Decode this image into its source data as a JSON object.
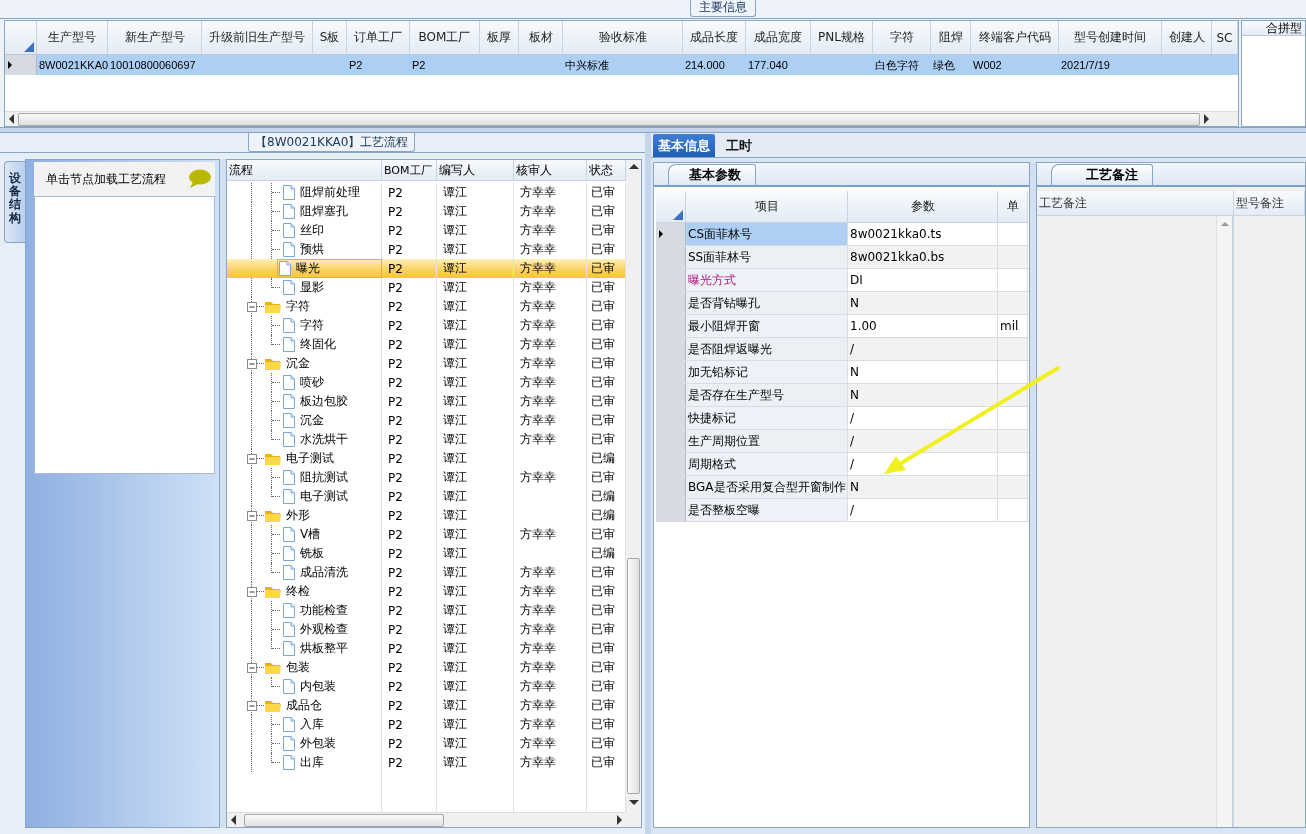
{
  "main_info": {
    "title": "主要信息",
    "columns": [
      "生产型号",
      "新生产型号",
      "升级前旧生产型号",
      "S板",
      "订单工厂",
      "BOM工厂",
      "板厚",
      "板材",
      "验收标准",
      "成品长度",
      "成品宽度",
      "PNL规格",
      "字符",
      "阻焊",
      "终端客户代码",
      "型号创建时间",
      "创建人",
      "SC"
    ],
    "rows": [
      {
        "selected": true,
        "cells": [
          "8W0021KKA0",
          "10010800060697",
          null,
          null,
          "P2",
          "P2",
          null,
          null,
          "中兴标准",
          "214.000",
          "177.040",
          null,
          "白色字符",
          "绿色",
          "W002",
          "2021/7/19",
          null,
          null
        ]
      }
    ]
  },
  "merge_panel": {
    "title": "合拼型"
  },
  "process_flow": {
    "title": "【8W0021KKA0】工艺流程",
    "side_tab": "设备结构",
    "hint": "单击节点加载工艺流程",
    "columns": [
      "流程",
      "BOM工厂",
      "编写人",
      "核审人",
      "状态"
    ],
    "groups": [
      {
        "children": [
          {
            "label": "阻焊前处理",
            "bom": "P2",
            "writer": "谭江",
            "reviewer": "方幸幸",
            "status": "已审",
            "selected": false
          },
          {
            "label": "阻焊塞孔",
            "bom": "P2",
            "writer": "谭江",
            "reviewer": "方幸幸",
            "status": "已审",
            "selected": false
          },
          {
            "label": "丝印",
            "bom": "P2",
            "writer": "谭江",
            "reviewer": "方幸幸",
            "status": "已审",
            "selected": false
          },
          {
            "label": "预烘",
            "bom": "P2",
            "writer": "谭江",
            "reviewer": "方幸幸",
            "status": "已审",
            "selected": false
          },
          {
            "label": "曝光",
            "bom": "P2",
            "writer": "谭江",
            "reviewer": "方幸幸",
            "status": "已审",
            "selected": true
          },
          {
            "label": "显影",
            "bom": "P2",
            "writer": "谭江",
            "reviewer": "方幸幸",
            "status": "已审",
            "selected": false
          }
        ]
      },
      {
        "label": "字符",
        "bom": "P2",
        "writer": "谭江",
        "reviewer": "方幸幸",
        "status": "已审",
        "selected": false,
        "expanded": true,
        "children": [
          {
            "label": "字符",
            "bom": "P2",
            "writer": "谭江",
            "reviewer": "方幸幸",
            "status": "已审",
            "selected": false
          },
          {
            "label": "终固化",
            "bom": "P2",
            "writer": "谭江",
            "reviewer": "方幸幸",
            "status": "已审",
            "selected": false
          }
        ]
      },
      {
        "label": "沉金",
        "bom": "P2",
        "writer": "谭江",
        "reviewer": "方幸幸",
        "status": "已审",
        "selected": false,
        "expanded": true,
        "children": [
          {
            "label": "喷砂",
            "bom": "P2",
            "writer": "谭江",
            "reviewer": "方幸幸",
            "status": "已审",
            "selected": false
          },
          {
            "label": "板边包胶",
            "bom": "P2",
            "writer": "谭江",
            "reviewer": "方幸幸",
            "status": "已审",
            "selected": false
          },
          {
            "label": "沉金",
            "bom": "P2",
            "writer": "谭江",
            "reviewer": "方幸幸",
            "status": "已审",
            "selected": false
          },
          {
            "label": "水洗烘干",
            "bom": "P2",
            "writer": "谭江",
            "reviewer": "方幸幸",
            "status": "已审",
            "selected": false
          }
        ]
      },
      {
        "label": "电子测试",
        "bom": "P2",
        "writer": "谭江",
        "status": "已编",
        "selected": false,
        "expanded": true,
        "children": [
          {
            "label": "阻抗测试",
            "bom": "P2",
            "writer": "谭江",
            "reviewer": "方幸幸",
            "status": "已审",
            "selected": false
          },
          {
            "label": "电子测试",
            "bom": "P2",
            "writer": "谭江",
            "status": "已编",
            "selected": false
          }
        ]
      },
      {
        "label": "外形",
        "bom": "P2",
        "writer": "谭江",
        "status": "已编",
        "selected": false,
        "expanded": true,
        "children": [
          {
            "label": "V槽",
            "bom": "P2",
            "writer": "谭江",
            "reviewer": "方幸幸",
            "status": "已审",
            "selected": false
          },
          {
            "label": "铣板",
            "bom": "P2",
            "writer": "谭江",
            "status": "已编",
            "selected": false
          },
          {
            "label": "成品清洗",
            "bom": "P2",
            "writer": "谭江",
            "reviewer": "方幸幸",
            "status": "已审",
            "selected": false
          }
        ]
      },
      {
        "label": "终检",
        "bom": "P2",
        "writer": "谭江",
        "reviewer": "方幸幸",
        "status": "已审",
        "selected": false,
        "expanded": true,
        "children": [
          {
            "label": "功能检查",
            "bom": "P2",
            "writer": "谭江",
            "reviewer": "方幸幸",
            "status": "已审",
            "selected": false
          },
          {
            "label": "外观检查",
            "bom": "P2",
            "writer": "谭江",
            "reviewer": "方幸幸",
            "status": "已审",
            "selected": false
          },
          {
            "label": "烘板整平",
            "bom": "P2",
            "writer": "谭江",
            "reviewer": "方幸幸",
            "status": "已审",
            "selected": false
          }
        ]
      },
      {
        "label": "包装",
        "bom": "P2",
        "writer": "谭江",
        "reviewer": "方幸幸",
        "status": "已审",
        "selected": false,
        "expanded": true,
        "children": [
          {
            "label": "内包装",
            "bom": "P2",
            "writer": "谭江",
            "reviewer": "方幸幸",
            "status": "已审",
            "selected": false
          }
        ]
      },
      {
        "label": "成品仓",
        "bom": "P2",
        "writer": "谭江",
        "reviewer": "方幸幸",
        "status": "已审",
        "selected": false,
        "expanded": true,
        "children": [
          {
            "label": "入库",
            "bom": "P2",
            "writer": "谭江",
            "reviewer": "方幸幸",
            "status": "已审",
            "selected": false
          },
          {
            "label": "外包装",
            "bom": "P2",
            "writer": "谭江",
            "reviewer": "方幸幸",
            "status": "已审",
            "selected": false
          },
          {
            "label": "出库",
            "bom": "P2",
            "writer": "谭江",
            "reviewer": "方幸幸",
            "status": "已审",
            "selected": false
          }
        ]
      }
    ]
  },
  "tabs": [
    {
      "label": "基本信息",
      "selected": true
    },
    {
      "label": "工时",
      "selected": false
    }
  ],
  "basic_params": {
    "title": "基本参数",
    "columns": [
      "项目",
      "参数",
      "单"
    ],
    "rows": [
      {
        "item": "CS面菲林号",
        "value": "8w0021kka0.ts",
        "selected": true,
        "emphasized": false
      },
      {
        "item": "SS面菲林号",
        "value": "8w0021kka0.bs",
        "selected": false,
        "emphasized": false
      },
      {
        "item": "曝光方式",
        "value": "DI",
        "selected": false,
        "emphasized": true
      },
      {
        "item": "是否背钻曝孔",
        "value": "N",
        "selected": false,
        "emphasized": false
      },
      {
        "item": "最小阻焊开窗",
        "value": "1.00",
        "unit": "mil",
        "selected": false,
        "emphasized": false
      },
      {
        "item": "是否阻焊返曝光",
        "value": "/",
        "selected": false,
        "emphasized": false
      },
      {
        "item": "加无铅标记",
        "value": "N",
        "selected": false,
        "emphasized": false
      },
      {
        "item": "是否存在生产型号",
        "value": "N",
        "selected": false,
        "emphasized": false
      },
      {
        "item": "快捷标记",
        "value": "/",
        "selected": false,
        "emphasized": false
      },
      {
        "item": "生产周期位置",
        "value": "/",
        "selected": false,
        "emphasized": false
      },
      {
        "item": "周期格式",
        "value": "/",
        "selected": false,
        "emphasized": false
      },
      {
        "item": "BGA是否采用复合型开窗制作",
        "value": "N",
        "selected": false,
        "emphasized": false
      },
      {
        "item": "是否整板空曝",
        "value": "/",
        "selected": false,
        "emphasized": false
      }
    ]
  },
  "process_notes": {
    "title": "工艺备注",
    "columns": [
      "工艺备注",
      "型号备注"
    ]
  }
}
